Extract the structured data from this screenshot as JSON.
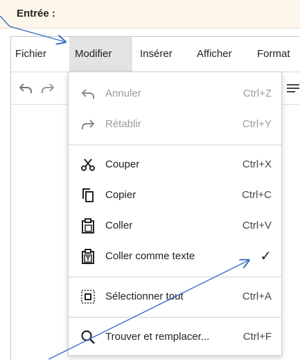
{
  "header": {
    "title": "Entrée :"
  },
  "menubar": {
    "items": [
      {
        "label": "Fichier"
      },
      {
        "label": "Modifier"
      },
      {
        "label": "Insérer"
      },
      {
        "label": "Afficher"
      },
      {
        "label": "Format"
      }
    ],
    "active_index": 1
  },
  "toolbar": {
    "icons": [
      "undo-icon",
      "redo-icon",
      "list-icon"
    ]
  },
  "dropdown": {
    "items": [
      {
        "label": "Annuler",
        "shortcut": "Ctrl+Z",
        "icon": "undo-icon",
        "enabled": false
      },
      {
        "label": "Rétablir",
        "shortcut": "Ctrl+Y",
        "icon": "redo-icon",
        "enabled": false
      },
      {
        "label": "Couper",
        "shortcut": "Ctrl+X",
        "icon": "scissors-icon",
        "enabled": true
      },
      {
        "label": "Copier",
        "shortcut": "Ctrl+C",
        "icon": "copy-icon",
        "enabled": true
      },
      {
        "label": "Coller",
        "shortcut": "Ctrl+V",
        "icon": "clipboard-icon",
        "enabled": true
      },
      {
        "label": "Coller comme texte",
        "shortcut": "✓",
        "icon": "clipboard-text-icon",
        "enabled": true,
        "checked": true
      },
      {
        "label": "Sélectionner tout",
        "shortcut": "Ctrl+A",
        "icon": "select-all-icon",
        "enabled": true
      },
      {
        "label": "Trouver et remplacer...",
        "shortcut": "Ctrl+F",
        "icon": "search-icon",
        "enabled": true
      }
    ]
  },
  "colors": {
    "header_bg": "#fdf6ea",
    "arrow": "#3a6cc0",
    "active_menu_bg": "#e3e3e3"
  }
}
